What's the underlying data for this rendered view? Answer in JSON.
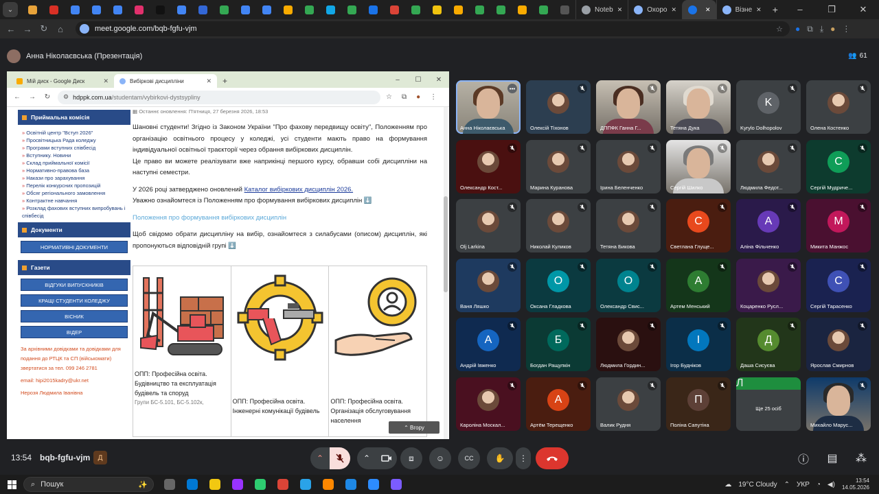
{
  "browser": {
    "tabs_favicon_colors": [
      "#e8a33a",
      "#d93025",
      "#4285f4",
      "#4285f4",
      "#4285f4",
      "#e1306c",
      "#111111",
      "#4285f4",
      "#3367d6",
      "#34a853",
      "#4285f4",
      "#4285f4",
      "#f9ab00",
      "#34a853",
      "#12a7e6",
      "#34a853",
      "#1a73e8",
      "#db4437",
      "#34a853",
      "#f1c40f",
      "#f9ab00",
      "#34a853",
      "#34a853",
      "#f9ab00",
      "#34a853",
      "#555555"
    ],
    "text_tabs": [
      {
        "label": "Noteb",
        "color": "#9aa0a6"
      },
      {
        "label": "Охоро",
        "color": "#8ab4f8"
      },
      {
        "label": "",
        "color": "#1a73e8",
        "active": true
      },
      {
        "label": "Візне",
        "color": "#8ab4f8"
      }
    ],
    "new_tab": "+",
    "url": "meet.google.com/bqb-fgfu-vjm"
  },
  "meet": {
    "presenter_label": "Анна Ніколаєвська (Презентація)",
    "participant_count": "61",
    "meeting_time": "13:54",
    "meeting_code": "bqb-fgfu-vjm",
    "meeting_code_badge": "Д"
  },
  "presentation": {
    "tabs": [
      {
        "label": "Мій диск - Google Диск",
        "icon_color": "#f9ab00"
      },
      {
        "label": "Вибіркові дисципліни",
        "icon_color": "#8ab4f8"
      }
    ],
    "url_host": "hdppk.com.ua",
    "url_path": "/studentam/vybirkovi-dystsypliny",
    "sidebar": {
      "admissions_title": "Приймальна комісія",
      "admissions_items": [
        "Освітній центр \"Вступ 2026\"",
        "Просвітницька Рада коледжу",
        "Програми вступних співбесід",
        "Вступнику. Новини",
        "Склад приймальної комісії",
        "Нормативно-правова база",
        "Накази про зарахування",
        "Перелік конкурсних пропозицій",
        "Обсяг регіонального замовлення",
        "Контрактне навчання",
        "Розклад фахових вступних випробувань і співбесід"
      ],
      "documents_title": "Документи",
      "documents_button": "НОРМАТИВНІ ДОКУМЕНТИ",
      "newspapers_title": "Газети",
      "newspaper_buttons": [
        "ВІДГУКИ ВИПУСКНИКІВ",
        "КРАЩІ СТУДЕНТИ КОЛЕДЖУ",
        "ВІСНИК",
        "ВІДЕР"
      ],
      "note": "За архівними довідками та довідками для подання до РТЦК та СП (військомати) звертатися за тел. 099 246 2781",
      "email": "email: hipi2015kadry@ukr.net",
      "contact": "Нерозя Людмила Іванівна"
    },
    "main": {
      "updated": "Останнє оновлення: П'ятниця, 27 березня 2026, 18:53",
      "p1": "Шановні студенти! Згідно із Законом України \"Про фахову передвищу освіту\", Положенням про організацію освітнього процесу у коледжі, усі студенти мають право на формування індивідуальної освітньої траєкторії через обрання вибіркових дисциплін.",
      "p2": "Це право ви можете реалізувати вже наприкінці першого курсу, обравши собі дисципліни на наступні семестри.",
      "p3_prefix": "У 2026 році затверджено оновлений",
      "p3_link": "Каталог вибіркових дисциплін 2026.",
      "p4": "Уважно ознайомтеся із Положенням про формування вибіркових дисциплін ⬇️",
      "p5_link": "Положення про формування вибіркових дисциплін",
      "p6": "Щоб свідомо обрати дисципліну на вибір, ознайомтеся з силабусами (описом) дисциплін, які пропонуються відповідній групі ⬇️",
      "cards": [
        {
          "caption": "ОПП: Професійна освіта. Будівництво та експлуатація будівель та споруд",
          "sub": "Групи БС-5.101, БС-5.102к,"
        },
        {
          "caption": "ОПП: Професійна освіта. Інженерні комунікації будівель",
          "sub": ""
        },
        {
          "caption": "ОПП: Професійна освіта. Організація обслуговування населення",
          "sub": ""
        }
      ],
      "back_to_top": "⌃ Вгору"
    }
  },
  "participants": [
    {
      "name": "Анна Ніколаєвська",
      "kind": "video",
      "active": true,
      "hair": "#5b3a26",
      "body": "#3d5a6b",
      "bg": ""
    },
    {
      "name": "Олексій Тіхонов",
      "kind": "photo",
      "bg": "#2c3e50"
    },
    {
      "name": "ДППФК Ганна Г...",
      "kind": "video",
      "hair": "#4a2e22",
      "body": "#7a3b4a",
      "bg": "#c7c0b3"
    },
    {
      "name": "Тетяна Дука",
      "kind": "video",
      "hair": "#e0dad0",
      "body": "#4b4b55",
      "bg": "#d6d2ca"
    },
    {
      "name": "Kyrylo Dolhopolov",
      "kind": "letter",
      "letter": "K",
      "color": "#5f6368",
      "bg": "#3c4043"
    },
    {
      "name": "Олена Костенко",
      "kind": "photo",
      "bg": "#3c4043"
    },
    {
      "name": "Олександр Кост...",
      "kind": "photo",
      "bg": "#4a1010"
    },
    {
      "name": "Марина Куранова",
      "kind": "photo",
      "bg": "#3c4043"
    },
    {
      "name": "Ірина Беленченко",
      "kind": "photo",
      "bg": "#3c4043"
    },
    {
      "name": "Сергій Шилко",
      "kind": "video",
      "hair": "#7a7a7a",
      "body": "#c8c8c8",
      "bg": "#e4e4e4"
    },
    {
      "name": "Людмила Федот...",
      "kind": "photo",
      "bg": "#3c4043"
    },
    {
      "name": "Сергій Мудриче...",
      "kind": "letter",
      "letter": "С",
      "color": "#0f9d58",
      "bg": "#0d3b2e"
    },
    {
      "name": "Olj Larkina",
      "kind": "photo",
      "bg": "#3c4043"
    },
    {
      "name": "Николай Куликов",
      "kind": "photo",
      "bg": "#3c4043"
    },
    {
      "name": "Тетяна Бикова",
      "kind": "photo",
      "bg": "#3c4043"
    },
    {
      "name": "Светлана Глуще...",
      "kind": "letter",
      "letter": "С",
      "color": "#e8491d",
      "bg": "#4a1d10"
    },
    {
      "name": "Аліна Фільченко",
      "kind": "letter",
      "letter": "А",
      "color": "#673ab7",
      "bg": "#2a1a4a"
    },
    {
      "name": "Микита Манжос",
      "kind": "letter",
      "letter": "М",
      "color": "#c2185b",
      "bg": "#4a1030"
    },
    {
      "name": "Ваня Ляшко",
      "kind": "photo",
      "bg": "#1e3a5f"
    },
    {
      "name": "Оксана Гладкова",
      "kind": "letter",
      "letter": "О",
      "color": "#0097a7",
      "bg": "#0b3a40"
    },
    {
      "name": "Олександр Свис...",
      "kind": "letter",
      "letter": "О",
      "color": "#00838f",
      "bg": "#0b3a40"
    },
    {
      "name": "Артем Менський",
      "kind": "letter",
      "letter": "А",
      "color": "#2e7d32",
      "bg": "#14361a"
    },
    {
      "name": "Коцаренко Русл...",
      "kind": "photo",
      "bg": "#3a1a4a"
    },
    {
      "name": "Сергій Тарасенко",
      "kind": "letter",
      "letter": "С",
      "color": "#3f51b5",
      "bg": "#1a2250"
    },
    {
      "name": "Андрій Івженко",
      "kind": "letter",
      "letter": "А",
      "color": "#1565c0",
      "bg": "#0f2a50"
    },
    {
      "name": "Богдан Ращупкін",
      "kind": "letter",
      "letter": "Б",
      "color": "#00695c",
      "bg": "#0b3a34"
    },
    {
      "name": "Людмила Гордин...",
      "kind": "photo",
      "bg": "#2a1010"
    },
    {
      "name": "Ігор Будніков",
      "kind": "letter",
      "letter": "І",
      "color": "#0277bd",
      "bg": "#0b2e48"
    },
    {
      "name": "Даша Сисуєва",
      "kind": "letter",
      "letter": "Д",
      "color": "#558b2f",
      "bg": "#22361a"
    },
    {
      "name": "Ярослав Смирнов",
      "kind": "photo",
      "bg": "#1a2440"
    },
    {
      "name": "Кароліна Москал...",
      "kind": "photo",
      "bg": "#4a1020"
    },
    {
      "name": "Артём Терещенко",
      "kind": "letter",
      "letter": "А",
      "color": "#d84315",
      "bg": "#4a1d10"
    },
    {
      "name": "Валик Рудня",
      "kind": "photo",
      "bg": "#3c4043"
    },
    {
      "name": "Поліна Сапутіна",
      "kind": "letter",
      "letter": "П",
      "color": "#5d4037",
      "bg": "#3a2618"
    },
    {
      "name": "Ще 25 осіб",
      "kind": "more",
      "letter": "Л",
      "color": "#1e8e3e",
      "bg": "#3c4043"
    },
    {
      "name": "Михайло Марус...",
      "kind": "video",
      "hair": "#2a2a2a",
      "body": "#1d2d44",
      "bg": "#0e3a6a"
    }
  ],
  "controls": {
    "colors": {
      "end": "#dc362e",
      "mic_off": "#f9dedc"
    }
  },
  "taskbar": {
    "search_label": "Пошук",
    "app_colors": [
      "#666666",
      "#0078d4",
      "#f2c811",
      "#9933ff",
      "#2ecc71",
      "#db4437",
      "#2aa3e8",
      "#ff8800",
      "#1e88e5",
      "#2d8cff",
      "#7b5cff"
    ],
    "weather": "19°C  Cloudy",
    "language": "УКР",
    "time": "13:54",
    "date": "14.05.2026"
  }
}
